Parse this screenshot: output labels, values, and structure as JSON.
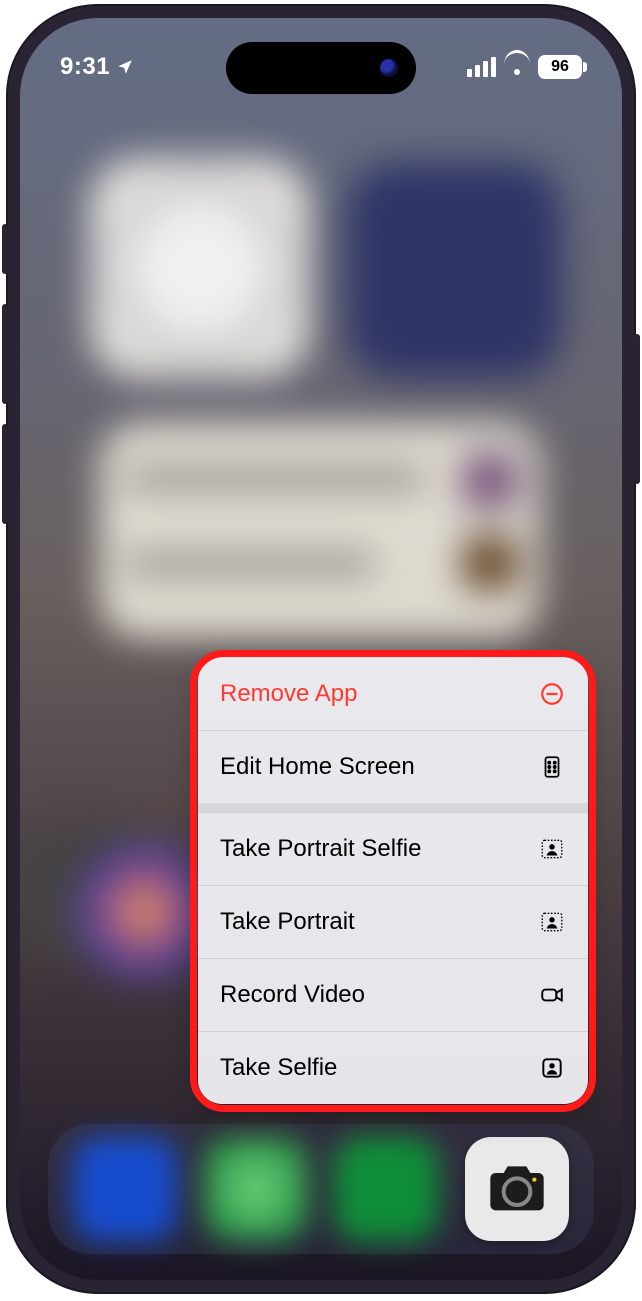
{
  "status_bar": {
    "time": "9:31",
    "battery_level": "96"
  },
  "context_menu": {
    "items": [
      {
        "label": "Remove App",
        "icon": "remove-circle-icon",
        "destructive": true
      },
      {
        "label": "Edit Home Screen",
        "icon": "apps-grid-icon",
        "destructive": false
      },
      {
        "label": "Take Portrait Selfie",
        "icon": "person-depth-icon",
        "destructive": false
      },
      {
        "label": "Take Portrait",
        "icon": "person-depth-icon",
        "destructive": false
      },
      {
        "label": "Record Video",
        "icon": "video-camera-icon",
        "destructive": false
      },
      {
        "label": "Take Selfie",
        "icon": "person-square-icon",
        "destructive": false
      }
    ]
  },
  "dock": {
    "focused_app": "Camera"
  }
}
